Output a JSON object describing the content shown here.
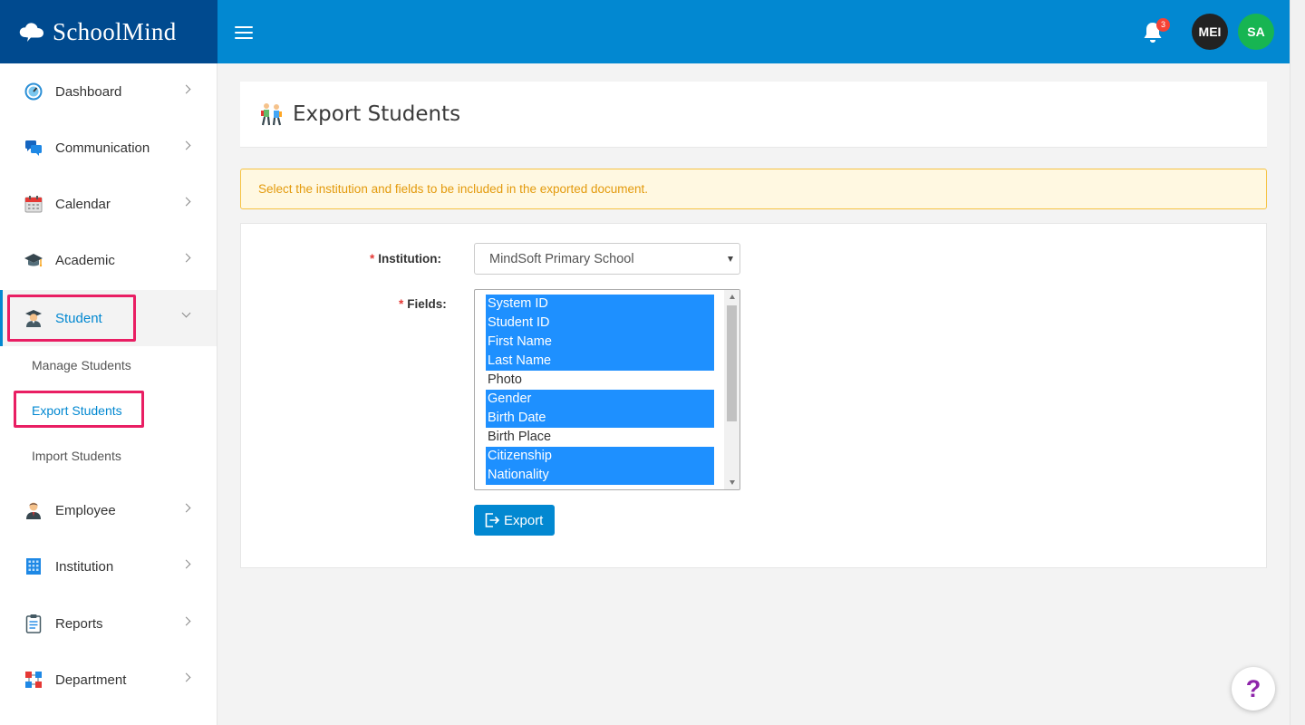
{
  "brand": {
    "name": "SchoolMind"
  },
  "header": {
    "notification_count": "3",
    "avatars": [
      {
        "initials": "MEI",
        "color": "#222222"
      },
      {
        "initials": "SA",
        "color": "#17b552"
      }
    ]
  },
  "sidebar": {
    "items": [
      {
        "label": "Dashboard",
        "icon": "dashboard-icon"
      },
      {
        "label": "Communication",
        "icon": "chat-icon"
      },
      {
        "label": "Calendar",
        "icon": "calendar-icon"
      },
      {
        "label": "Academic",
        "icon": "graduation-cap-icon"
      },
      {
        "label": "Student",
        "icon": "student-icon",
        "active": true
      },
      {
        "label": "Employee",
        "icon": "employee-icon"
      },
      {
        "label": "Institution",
        "icon": "building-icon"
      },
      {
        "label": "Reports",
        "icon": "clipboard-icon"
      },
      {
        "label": "Department",
        "icon": "department-icon"
      }
    ],
    "student_sub": [
      {
        "label": "Manage Students"
      },
      {
        "label": "Export Students",
        "active": true
      },
      {
        "label": "Import Students"
      }
    ]
  },
  "page": {
    "title": "Export Students",
    "alert": "Select the institution and fields to be included in the exported document.",
    "form": {
      "required_mark": "*",
      "institution_label": "Institution:",
      "institution_value": "MindSoft Primary School",
      "fields_label": "Fields:",
      "fields_options": [
        {
          "label": "System ID",
          "selected": true
        },
        {
          "label": "Student ID",
          "selected": true
        },
        {
          "label": "First Name",
          "selected": true
        },
        {
          "label": "Last Name",
          "selected": true
        },
        {
          "label": "Photo",
          "selected": false
        },
        {
          "label": "Gender",
          "selected": true
        },
        {
          "label": "Birth Date",
          "selected": true
        },
        {
          "label": "Birth Place",
          "selected": false
        },
        {
          "label": "Citizenship",
          "selected": true
        },
        {
          "label": "Nationality",
          "selected": true
        }
      ],
      "export_label": "Export"
    }
  },
  "help": {
    "label": "?"
  },
  "colors": {
    "header": "#0288d1",
    "logo_bg": "#004a8f",
    "accent": "#0288d1",
    "selection": "#1e90ff",
    "highlight_box": "#e91e63",
    "alert_text": "#e39a0c",
    "help": "#8e24aa"
  }
}
